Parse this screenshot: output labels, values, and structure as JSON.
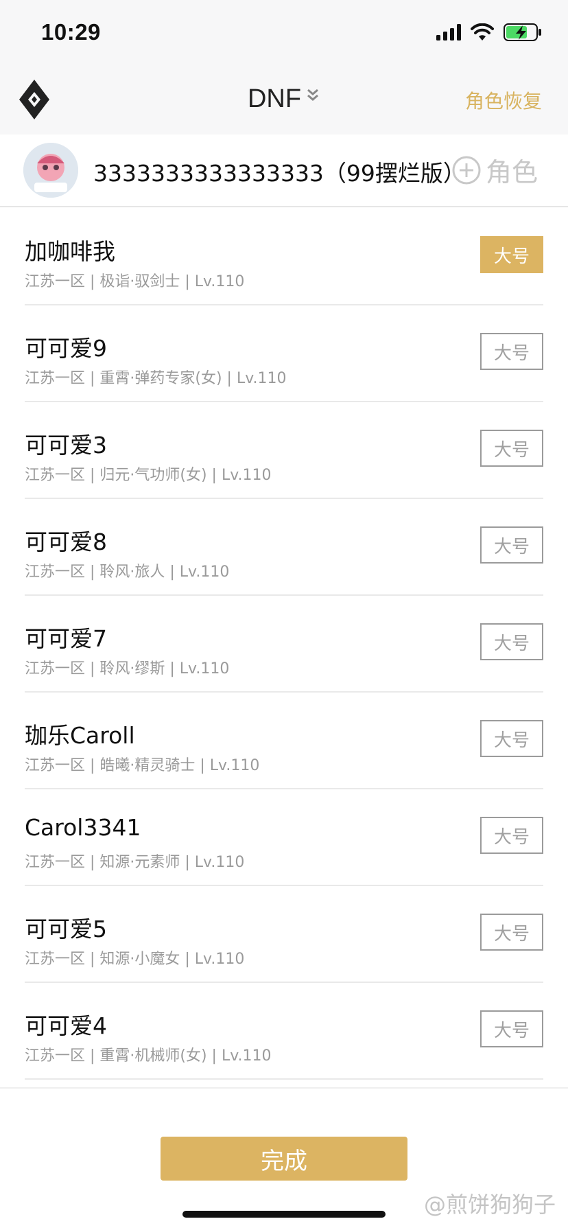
{
  "status_bar": {
    "time": "10:29"
  },
  "nav": {
    "title": "DNF",
    "restore_label": "角色恢复"
  },
  "account": {
    "name": "3333333333333333（99摆烂版）",
    "add_role_label": "角色"
  },
  "roles": [
    {
      "name": "加咖啡我",
      "meta": "江苏一区 | 极诣·驭剑士 | Lv.110",
      "badge": "大号",
      "main": true
    },
    {
      "name": "可可爱9",
      "meta": "江苏一区 | 重霄·弹药专家(女) | Lv.110",
      "badge": "大号",
      "main": false
    },
    {
      "name": "可可爱3",
      "meta": "江苏一区 | 归元·气功师(女) | Lv.110",
      "badge": "大号",
      "main": false
    },
    {
      "name": "可可爱8",
      "meta": "江苏一区 | 聆风·旅人 | Lv.110",
      "badge": "大号",
      "main": false
    },
    {
      "name": "可可爱7",
      "meta": "江苏一区 | 聆风·缪斯 | Lv.110",
      "badge": "大号",
      "main": false
    },
    {
      "name": "珈乐Caroll",
      "meta": "江苏一区 | 皓曦·精灵骑士 | Lv.110",
      "badge": "大号",
      "main": false
    },
    {
      "name": "Carol3341",
      "meta": "江苏一区 | 知源·元素师 | Lv.110",
      "badge": "大号",
      "main": false
    },
    {
      "name": "可可爱5",
      "meta": "江苏一区 | 知源·小魔女 | Lv.110",
      "badge": "大号",
      "main": false
    },
    {
      "name": "可可爱4",
      "meta": "江苏一区 | 重霄·机械师(女) | Lv.110",
      "badge": "大号",
      "main": false
    }
  ],
  "footer": {
    "done_label": "完成",
    "watermark": "@煎饼狗狗子"
  },
  "colors": {
    "accent": "#dcb462",
    "nav_bg": "#f7f7f8",
    "meta_text": "#9a9a9a"
  }
}
